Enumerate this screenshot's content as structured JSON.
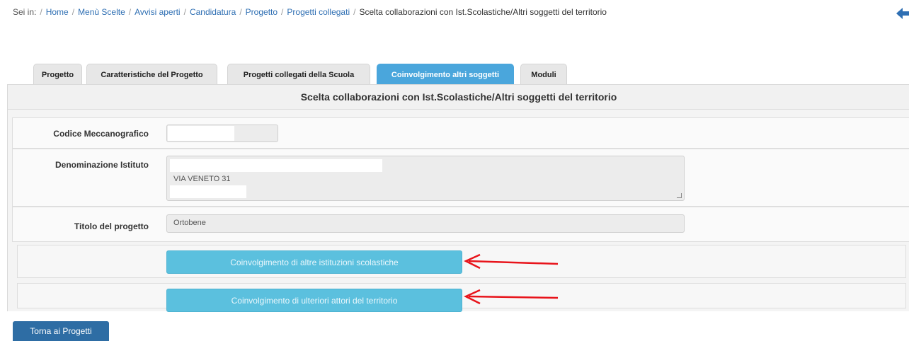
{
  "breadcrumb": {
    "prefix": "Sei in:",
    "items": [
      "Home",
      "Menù Scelte",
      "Avvisi aperti",
      "Candidatura",
      "Progetto",
      "Progetti collegati"
    ],
    "current": "Scelta collaborazioni con Ist.Scolastiche/Altri soggetti del territorio"
  },
  "tabs": [
    {
      "label": "Progetto"
    },
    {
      "label": "Caratteristiche del Progetto"
    },
    {
      "label": "Progetti collegati della Scuola"
    },
    {
      "label": "Coinvolgimento altri soggetti",
      "active": true
    },
    {
      "label": "Moduli"
    }
  ],
  "panel": {
    "title": "Scelta collaborazioni con Ist.Scolastiche/Altri soggetti del territorio"
  },
  "form": {
    "codice_label": "Codice Meccanografico",
    "codice_value": "",
    "denominazione_label": "Denominazione Istituto",
    "denominazione_line2": "VIA VENETO 31",
    "titolo_label": "Titolo del progetto",
    "titolo_value": "Ortobene"
  },
  "buttons": {
    "istituzioni": "Coinvolgimento di altre istituzioni scolastiche",
    "attori": "Coinvolgimento di ulteriori attori del territorio",
    "back": "Torna ai Progetti"
  },
  "colors": {
    "active_tab": "#4aa6dc",
    "action_button": "#5bc0de",
    "back_button": "#2e6da4",
    "link": "#2f6fb3",
    "annotation_arrow": "#e8141b"
  }
}
